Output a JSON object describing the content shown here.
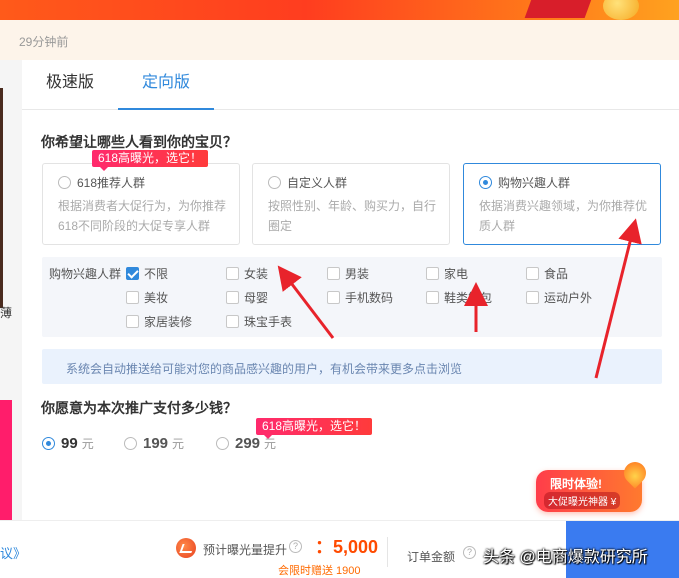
{
  "notice": {
    "time": "29分钟前"
  },
  "left_strip": {
    "char": "薄"
  },
  "tabs": [
    {
      "label": "极速版",
      "active": false
    },
    {
      "label": "定向版",
      "active": true
    }
  ],
  "audience": {
    "question": "你希望让哪些人看到你的宝贝？",
    "badge": "618高曝光，选它！",
    "cards": [
      {
        "title": "618推荐人群",
        "desc": "根据消费者大促行为，为你推荐618不同阶段的大促专享人群",
        "selected": false
      },
      {
        "title": "自定义人群",
        "desc": "按照性别、年龄、购买力，自行圈定",
        "selected": false
      },
      {
        "title": "购物兴趣人群",
        "desc": "依据消费兴趣领域，为你推荐优质人群",
        "selected": true
      }
    ]
  },
  "interests": {
    "label": "购物兴趣人群",
    "items": [
      {
        "label": "不限",
        "checked": true
      },
      {
        "label": "女装",
        "checked": false
      },
      {
        "label": "男装",
        "checked": false
      },
      {
        "label": "家电",
        "checked": false
      },
      {
        "label": "食品",
        "checked": false
      },
      {
        "label": "美妆",
        "checked": false
      },
      {
        "label": "母婴",
        "checked": false
      },
      {
        "label": "手机数码",
        "checked": false
      },
      {
        "label": "鞋类箱包",
        "checked": false
      },
      {
        "label": "运动户外",
        "checked": false
      },
      {
        "label": "家居装修",
        "checked": false
      },
      {
        "label": "珠宝手表",
        "checked": false
      }
    ]
  },
  "info_text": "系统会自动推送给可能对您的商品感兴趣的用户，有机会带来更多点击浏览",
  "payment": {
    "question": "你愿意为本次推广支付多少钱？",
    "badge": "618高曝光，选它！",
    "options": [
      {
        "value": "99",
        "unit": "元",
        "selected": true
      },
      {
        "value": "199",
        "unit": "元",
        "selected": false
      },
      {
        "value": "299",
        "unit": "元",
        "selected": false
      }
    ]
  },
  "promo": {
    "line1": "限时体验!",
    "line2": "大促曝光神器 ¥"
  },
  "footer": {
    "left_link": "议》",
    "gain_label": "预计曝光量提升",
    "help": "?",
    "gain_value": "：5,000",
    "gift": "会限时赠送 1900",
    "order_label": "订单金额",
    "order_help": "?"
  },
  "watermark": "头条 @电商爆款研究所",
  "colors": {
    "accent": "#3089dc",
    "badge": "#ff2a6d",
    "highlight": "#ff4a00",
    "submit": "#3a7bf0",
    "arrow": "#e8232b"
  }
}
